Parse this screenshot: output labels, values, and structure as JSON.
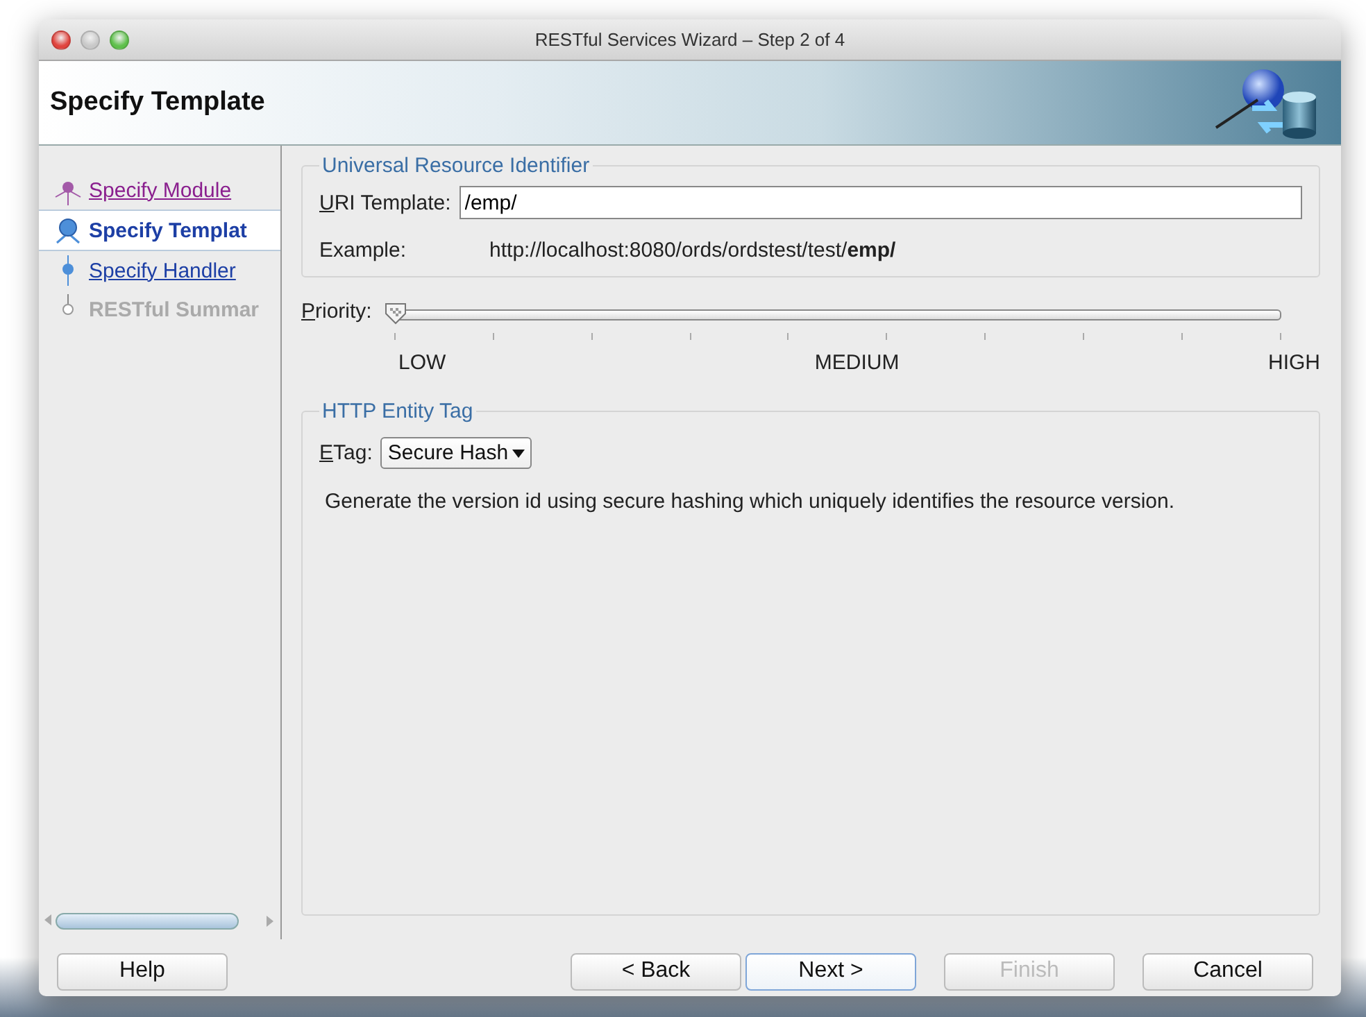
{
  "window": {
    "title": "RESTful Services Wizard – Step 2 of 4"
  },
  "header": {
    "title": "Specify Template"
  },
  "steps": [
    {
      "label": "Specify Module",
      "kind": "visited",
      "selected": false
    },
    {
      "label": "Specify Templat",
      "kind": "link",
      "selected": true
    },
    {
      "label": "Specify Handler",
      "kind": "link",
      "selected": false
    },
    {
      "label": "RESTful Summar",
      "kind": "disabled",
      "selected": false
    }
  ],
  "uri_group": {
    "title": "Universal Resource Identifier",
    "uri_label": "URI Template:",
    "uri_value": "/emp/",
    "example_label": "Example:",
    "example": "http://localhost:8080/ords/ordstest/test/**emp/**"
  },
  "priority": {
    "label": "Priority:",
    "level": 0,
    "scale": [
      "LOW",
      "MEDIUM",
      "HIGH"
    ]
  },
  "etag_group": {
    "title": "HTTP Entity Tag",
    "label": "ETag:",
    "value": "Secure Hash",
    "description": "Generate the version id using secure hashing which uniquely identifies the resource version."
  },
  "buttons": [
    {
      "label": "Help",
      "kind": "help",
      "disabled": false,
      "default": false
    },
    {
      "label": "< Back",
      "kind": "nav",
      "disabled": false,
      "default": false
    },
    {
      "label": "Next >",
      "kind": "nav",
      "disabled": false,
      "default": true
    },
    {
      "label": "Finish",
      "kind": "nav",
      "disabled": true,
      "default": false
    },
    {
      "label": "Cancel",
      "kind": "nav",
      "disabled": false,
      "default": false
    }
  ]
}
